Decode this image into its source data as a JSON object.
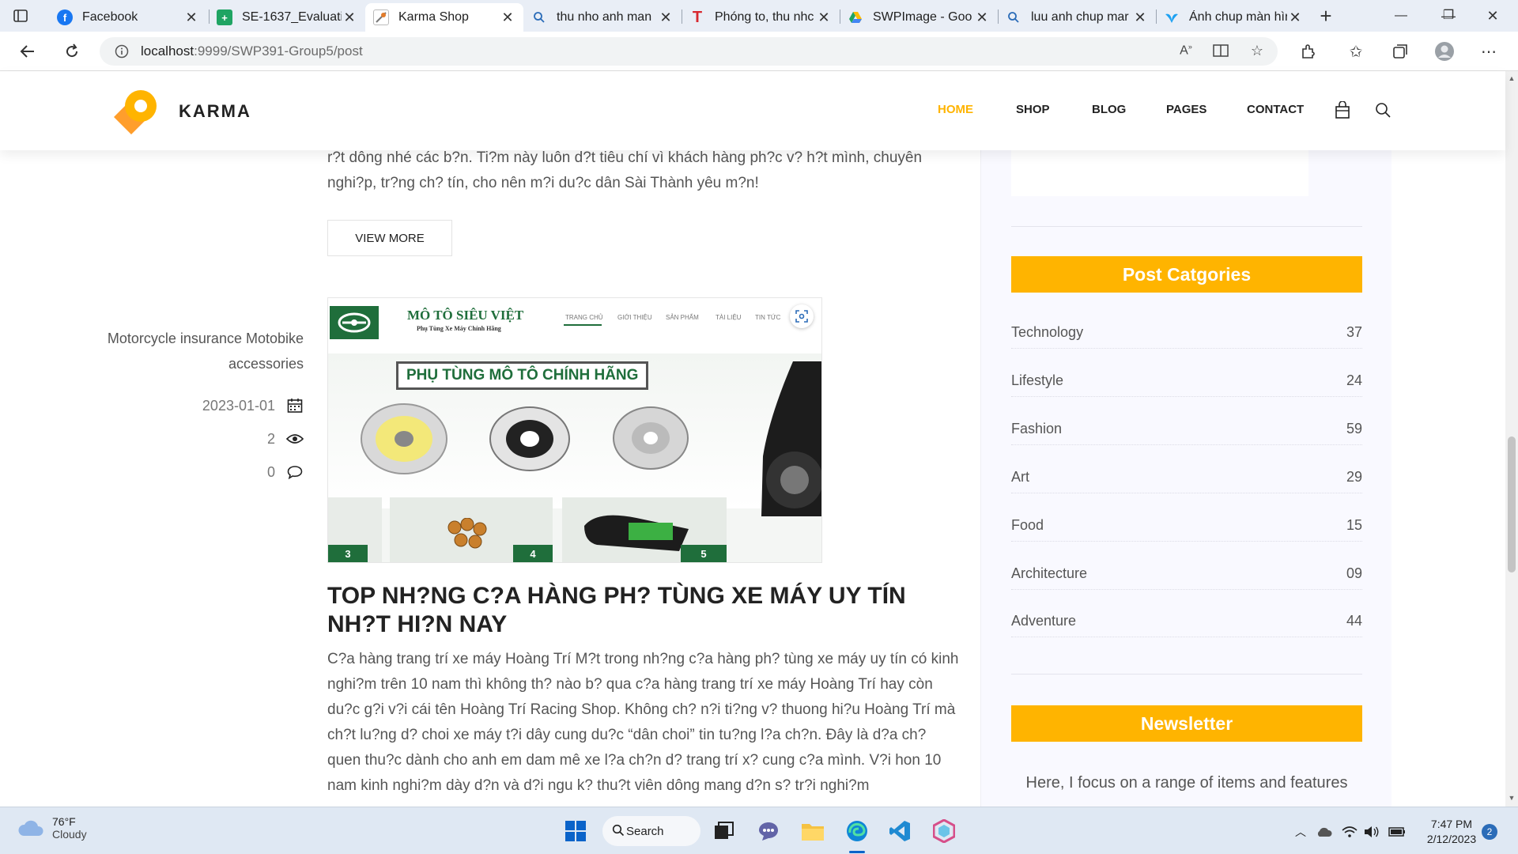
{
  "browser": {
    "tabs": [
      {
        "title": "Facebook",
        "icon": "facebook-icon"
      },
      {
        "title": "SE-1637_Evaluatic",
        "icon": "sheets-icon"
      },
      {
        "title": "Karma Shop",
        "icon": "karma-icon"
      },
      {
        "title": "thu nho anh man",
        "icon": "search-icon"
      },
      {
        "title": "Phóng to, thu nhc",
        "icon": "t-icon"
      },
      {
        "title": "SWPImage - Goo",
        "icon": "drive-icon"
      },
      {
        "title": "luu anh chup mar",
        "icon": "search-icon"
      },
      {
        "title": "Ảnh chup màn hìr",
        "icon": "bird-icon"
      }
    ],
    "url_host": "localhost",
    "url_path": ":9999/SWP391-Group5/post"
  },
  "site": {
    "logo_text": "KARMA",
    "menu": [
      "HOME",
      "SHOP",
      "BLOG",
      "PAGES",
      "CONTACT"
    ],
    "accent_color": "#ffb400"
  },
  "main": {
    "intro_text": "r?t dông nhé các b?n. Ti?m này luôn d?t tiêu chí vì khách hàng ph?c v? h?t mình, chuyên nghi?p, tr?ng ch? tín, cho nên m?i du?c dân Sài Thành yêu m?n!",
    "view_more": "VIEW MORE",
    "post": {
      "tags": "Motorcycle insurance Motobike accessories",
      "date": "2023-01-01",
      "views": "2",
      "comments": "0",
      "title": "TOP NH?NG C?A HÀNG PH? TÙNG XE MÁY UY TÍN NH?T HI?N NAY",
      "excerpt": "C?a hàng trang trí xe máy Hoàng Trí M?t trong nh?ng c?a hàng ph? tùng xe máy uy tín có kinh nghi?m trên 10 nam thì không th? nào b? qua c?a hàng trang trí xe máy Hoàng Trí hay còn du?c g?i v?i cái tên Hoàng Trí Racing Shop. Không ch? n?i ti?ng v? thuong hi?u Hoàng Trí mà ch?t lu?ng d? choi xe máy t?i dây cung du?c “dân choi” tin tu?ng l?a ch?n. Ðây là d?a ch? quen thu?c dành cho anh em dam mê xe l?a ch?n d? trang trí x? cung c?a mình. V?i hon 10 nam kinh nghi?m dày d?n và d?i ngu k? thu?t viên dông mang d?n s? tr?i nghi?m",
      "image": {
        "brand": "MÔ TÔ SIÊU VIỆT",
        "brand_sub": "Phụ Tùng Xe Máy Chính Hãng",
        "nav": [
          "TRANG CHỦ",
          "GIỚI THIỆU",
          "SẢN PHẨM",
          "TÀI LIỆU",
          "TIN TỨC"
        ],
        "banner": "PHỤ TÙNG MÔ TÔ CHÍNH HÃNG",
        "card_numbers": [
          "3",
          "4",
          "5"
        ]
      }
    }
  },
  "sidebar": {
    "categories_heading": "Post Catgories",
    "categories": [
      {
        "name": "Technology",
        "count": "37"
      },
      {
        "name": "Lifestyle",
        "count": "24"
      },
      {
        "name": "Fashion",
        "count": "59"
      },
      {
        "name": "Art",
        "count": "29"
      },
      {
        "name": "Food",
        "count": "15"
      },
      {
        "name": "Architecture",
        "count": "09"
      },
      {
        "name": "Adventure",
        "count": "44"
      }
    ],
    "newsletter_heading": "Newsletter",
    "newsletter_text": "Here, I focus on a range of items and features"
  },
  "taskbar": {
    "temperature": "76°F",
    "condition": "Cloudy",
    "search_label": "Search",
    "time": "7:47 PM",
    "date": "2/12/2023",
    "notifications": "2"
  }
}
